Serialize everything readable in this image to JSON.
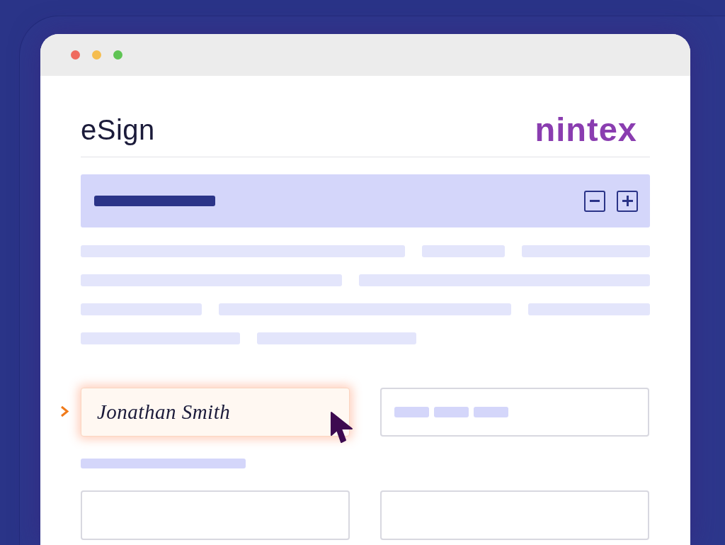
{
  "header": {
    "title": "eSign",
    "logo": "nintex"
  },
  "fields": [
    {
      "kind": "signature",
      "value": "Jonathan Smith",
      "active": true
    },
    {
      "kind": "chips",
      "active": false
    },
    {
      "kind": "empty",
      "active": false
    },
    {
      "kind": "empty",
      "active": false
    }
  ]
}
